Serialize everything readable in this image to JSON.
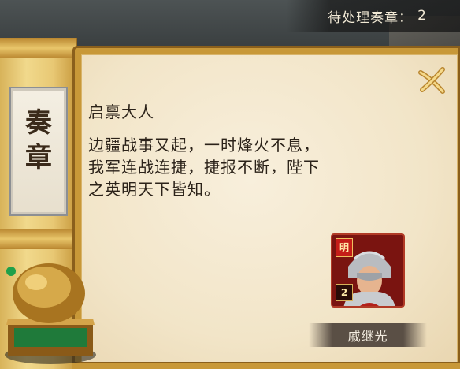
{
  "header": {
    "pending_label": "待处理奏章：",
    "pending_count": "2"
  },
  "scroll": {
    "char_1": "奏",
    "char_2": "章"
  },
  "memorial": {
    "greeting": "启禀大人",
    "body": "边疆战事又起，一时烽火不息，我军连战连捷，捷报不断，陛下之英明天下皆知。"
  },
  "general": {
    "faction_badge": "明",
    "rank": "2",
    "name": "戚继光"
  },
  "colors": {
    "gold": "#c89838",
    "paper": "#f2e5c8",
    "portrait_red": "#8c1a16"
  }
}
